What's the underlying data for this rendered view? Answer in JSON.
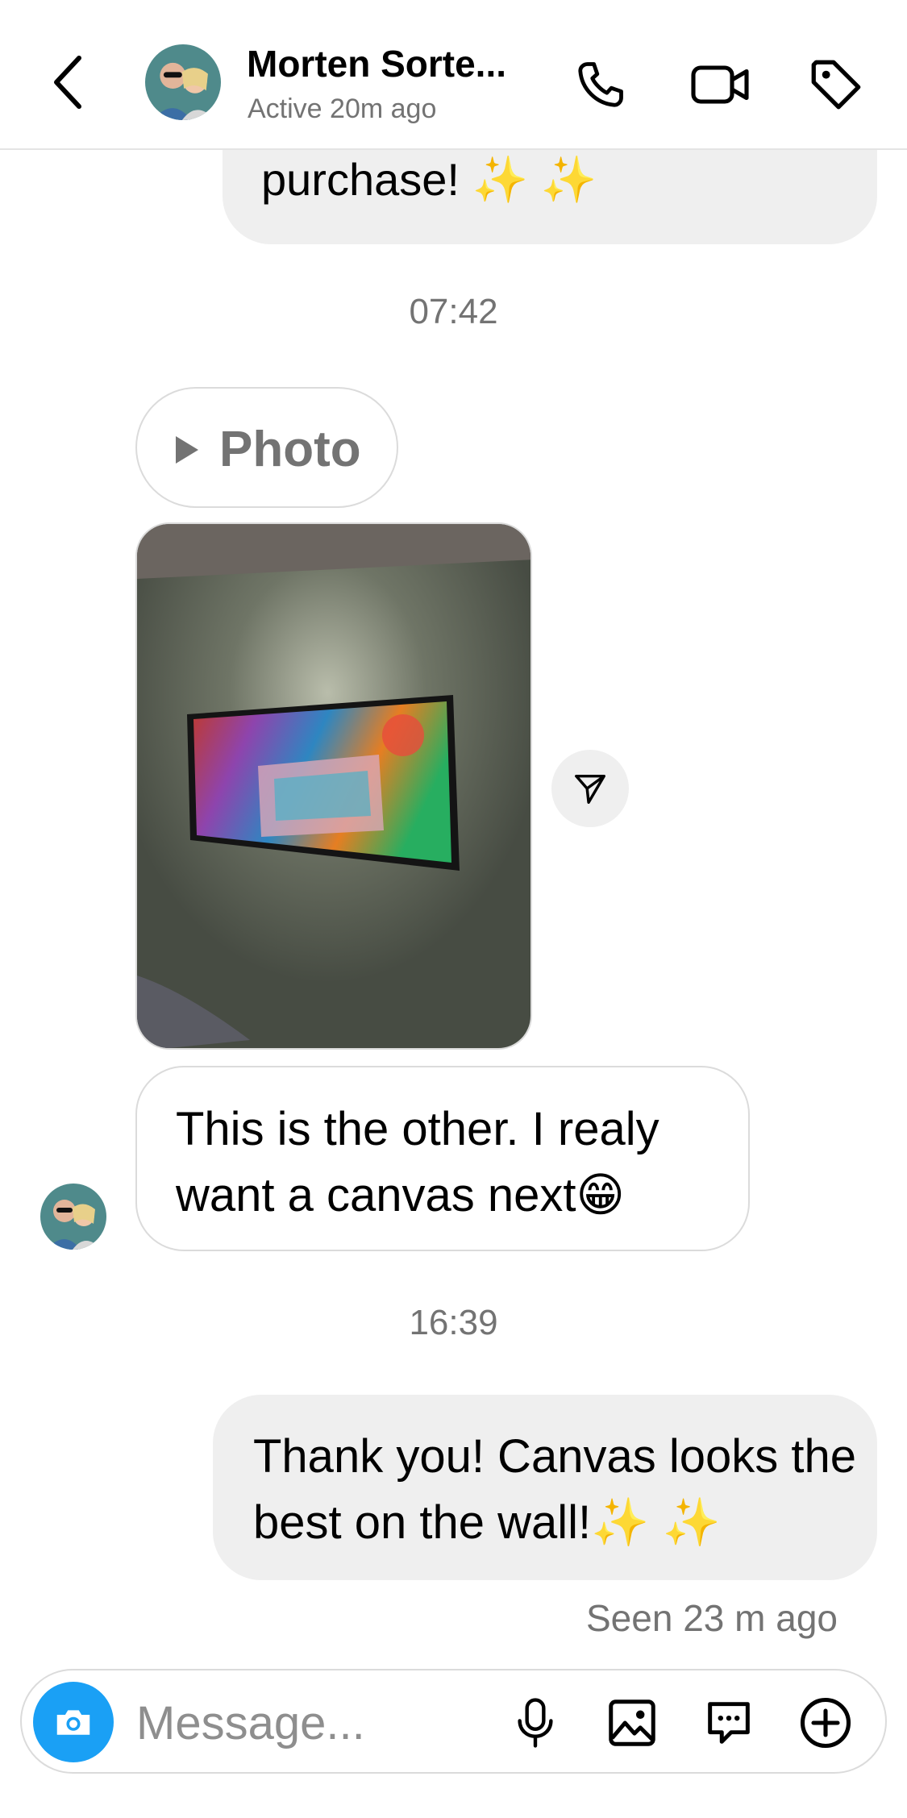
{
  "header": {
    "contact_name": "Morten Sorte...",
    "status": "Active 20m ago",
    "icons": [
      "back-chevron-icon",
      "phone-icon",
      "video-camera-icon",
      "tag-icon"
    ]
  },
  "messages": {
    "prev_outgoing_tail": "purchase! ✨ ✨",
    "time_1": "07:42",
    "photo_label": "Photo",
    "incoming_text": "This is the other. I realy want a canvas next😁",
    "time_2": "16:39",
    "outgoing_text": "Thank you! Canvas looks the best on the wall!✨ ✨",
    "seen": "Seen 23 m ago"
  },
  "composer": {
    "placeholder": "Message...",
    "icons": [
      "camera-icon",
      "microphone-icon",
      "gallery-icon",
      "sticker-chat-icon",
      "plus-icon"
    ]
  },
  "colors": {
    "accent_blue": "#1aa0f5",
    "bubble_gray": "#efefef",
    "muted_text": "#737373",
    "border": "#dbdbdb"
  }
}
